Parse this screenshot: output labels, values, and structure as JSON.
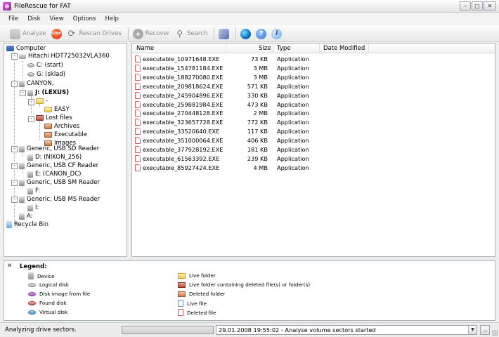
{
  "window": {
    "title": "FileRescue for FAT"
  },
  "menu": [
    "File",
    "Disk",
    "View",
    "Options",
    "Help"
  ],
  "toolbar": {
    "analyze": "Analyze",
    "stop_icon": "STOP",
    "rescan": "Rescan Drives",
    "recover": "Recover",
    "search": "Search"
  },
  "tree": [
    {
      "label": "Computer",
      "icon": "computer-icon",
      "bold": false
    },
    {
      "label": "Hitachi HDT725032VLA360",
      "icon": "hard-disk-icon",
      "bold": false
    },
    {
      "label": "C: (start)",
      "icon": "volume-icon",
      "bold": false
    },
    {
      "label": "G: (sklad)",
      "icon": "volume-icon",
      "bold": false
    },
    {
      "label": "CANYON,",
      "icon": "usb-device-icon",
      "bold": false
    },
    {
      "label": "J: (LEXUS)",
      "icon": "usb-volume-icon",
      "bold": true
    },
    {
      "label": "-",
      "icon": "folder-icon",
      "bold": false
    },
    {
      "label": "EASY",
      "icon": "folder-icon",
      "bold": false
    },
    {
      "label": "Lost files",
      "icon": "folder-deleted-content-icon",
      "bold": false
    },
    {
      "label": "Archives",
      "icon": "deleted-folder-icon",
      "bold": false
    },
    {
      "label": "Executable",
      "icon": "deleted-folder-icon",
      "bold": false
    },
    {
      "label": "Images",
      "icon": "deleted-folder-icon",
      "bold": false
    },
    {
      "label": "Generic, USB SD Reader",
      "icon": "usb-device-icon",
      "bold": false
    },
    {
      "label": "D: (NIKON_256)",
      "icon": "usb-volume-icon",
      "bold": false
    },
    {
      "label": "Generic, USB CF Reader",
      "icon": "usb-device-icon",
      "bold": false
    },
    {
      "label": "E: (CANON_DC)",
      "icon": "usb-volume-icon",
      "bold": false
    },
    {
      "label": "Generic, USB SM Reader",
      "icon": "usb-device-icon",
      "bold": false
    },
    {
      "label": "F:",
      "icon": "usb-volume-icon",
      "bold": false
    },
    {
      "label": "Generic, USB MS Reader",
      "icon": "usb-device-icon",
      "bold": false
    },
    {
      "label": "I:",
      "icon": "usb-volume-icon",
      "bold": false
    },
    {
      "label": "A:",
      "icon": "floppy-icon",
      "bold": false
    },
    {
      "label": "Recycle Bin",
      "icon": "recycle-bin-icon",
      "bold": false
    }
  ],
  "file_list": {
    "columns": [
      "Name",
      "Size",
      "Type",
      "Date Modified"
    ],
    "rows": [
      {
        "name": "executable_10971648.EXE",
        "size": "73 KB",
        "type": "Application",
        "date": ""
      },
      {
        "name": "executable_154781184.EXE",
        "size": "3 MB",
        "type": "Application",
        "date": ""
      },
      {
        "name": "executable_188270080.EXE",
        "size": "3 MB",
        "type": "Application",
        "date": ""
      },
      {
        "name": "executable_209818624.EXE",
        "size": "571 KB",
        "type": "Application",
        "date": ""
      },
      {
        "name": "executable_245904896.EXE",
        "size": "330 KB",
        "type": "Application",
        "date": ""
      },
      {
        "name": "executable_259881984.EXE",
        "size": "473 KB",
        "type": "Application",
        "date": ""
      },
      {
        "name": "executable_270448128.EXE",
        "size": "2 MB",
        "type": "Application",
        "date": ""
      },
      {
        "name": "executable_323657728.EXE",
        "size": "772 KB",
        "type": "Application",
        "date": ""
      },
      {
        "name": "executable_33520640.EXE",
        "size": "117 KB",
        "type": "Application",
        "date": ""
      },
      {
        "name": "executable_351000064.EXE",
        "size": "406 KB",
        "type": "Application",
        "date": ""
      },
      {
        "name": "executable_377928192.EXE",
        "size": "181 KB",
        "type": "Application",
        "date": ""
      },
      {
        "name": "executable_61563392.EXE",
        "size": "239 KB",
        "type": "Application",
        "date": ""
      },
      {
        "name": "executable_85927424.EXE",
        "size": "4 MB",
        "type": "Application",
        "date": ""
      }
    ]
  },
  "legend": {
    "title": "Legend:",
    "left": [
      {
        "label": "Device",
        "icon": "device-icon"
      },
      {
        "label": "Logical disk",
        "icon": "logical-disk-icon"
      },
      {
        "label": "Disk image from file",
        "icon": "disk-image-icon"
      },
      {
        "label": "Found disk",
        "icon": "found-disk-icon"
      },
      {
        "label": "Virtual disk",
        "icon": "virtual-disk-icon"
      }
    ],
    "right": [
      {
        "label": "Live folder",
        "icon": "live-folder-icon"
      },
      {
        "label": "Live folder containing deleted file(s) or folder(s)",
        "icon": "live-folder-deleted-icon"
      },
      {
        "label": "Deleted folder",
        "icon": "deleted-folder-icon"
      },
      {
        "label": "Live file",
        "icon": "live-file-icon"
      },
      {
        "label": "Deleted file",
        "icon": "deleted-file-icon"
      }
    ]
  },
  "status": {
    "text": "Analyzing drive sectors.",
    "log": "29.01.2008 19:55:02 - Analyse volume sectors started",
    "more": "..."
  }
}
